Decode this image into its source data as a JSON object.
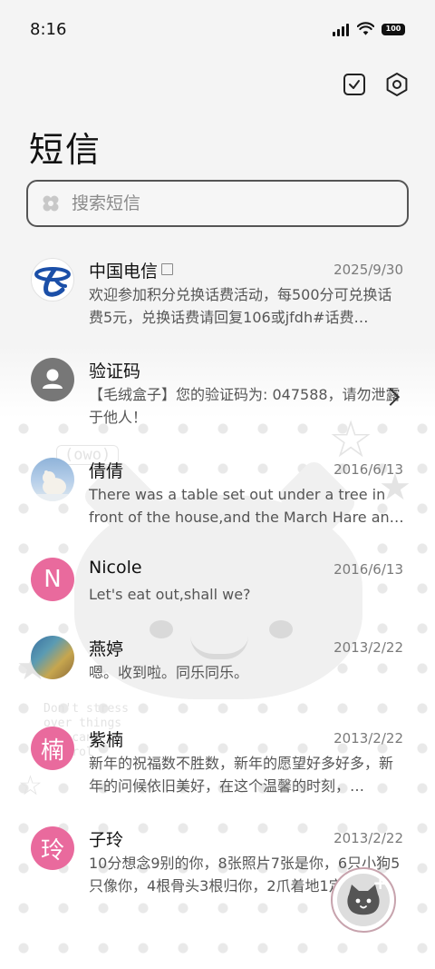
{
  "status_bar": {
    "time": "8:16",
    "battery": "100"
  },
  "header": {
    "title": "短信"
  },
  "search": {
    "placeholder": "搜索短信"
  },
  "conversations": [
    {
      "name": "中国电信",
      "date": "2025/9/30",
      "preview": "欢迎参加积分兑换话费活动，每500分可兑换话费5元，兑换话费请回复106或jfdh#话费…",
      "avatar": "china-telecom-logo"
    },
    {
      "name": "验证码",
      "date": "",
      "preview": "【毛绒盒子】您的验证码为: 047588，请勿泄露于他人！",
      "avatar": "person-icon"
    },
    {
      "name": "倩倩",
      "date": "2016/6/13",
      "preview": "There was a table set out under a tree in front of the house,and the March Hare an…",
      "avatar": "polar-bear-photo"
    },
    {
      "name": "Nicole",
      "date": "2016/6/13",
      "preview": "Let's eat out,shall we?",
      "avatar_letter": "N"
    },
    {
      "name": "燕婷",
      "date": "2013/2/22",
      "preview": "嗯。收到啦。同乐同乐。",
      "avatar": "landscape-photo"
    },
    {
      "name": "紫楠",
      "date": "2013/2/22",
      "preview": "新年的祝福数不胜数，新年的愿望好多好多，新年的问候依旧美好，在这个温馨的时刻，…",
      "avatar_letter": "楠"
    },
    {
      "name": "子玲",
      "date": "2013/2/22",
      "preview": "10分想念9别的你，8张照片7张是你，6只小狗5只像你，4根骨头3根归你，2爪着地1定…",
      "avatar_letter": "玲"
    }
  ],
  "background_text": {
    "face": "(owo)",
    "lines": [
      "Don't stress",
      "over things",
      "you can't",
      "control"
    ]
  },
  "colors": {
    "pink_avatar": "#e96a9d",
    "search_border": "#555555"
  },
  "icons": [
    "signal-icon",
    "wifi-icon",
    "battery-icon",
    "checkbox-icon",
    "settings-icon",
    "search-icon",
    "chevron-right-icon",
    "compose-icon"
  ]
}
